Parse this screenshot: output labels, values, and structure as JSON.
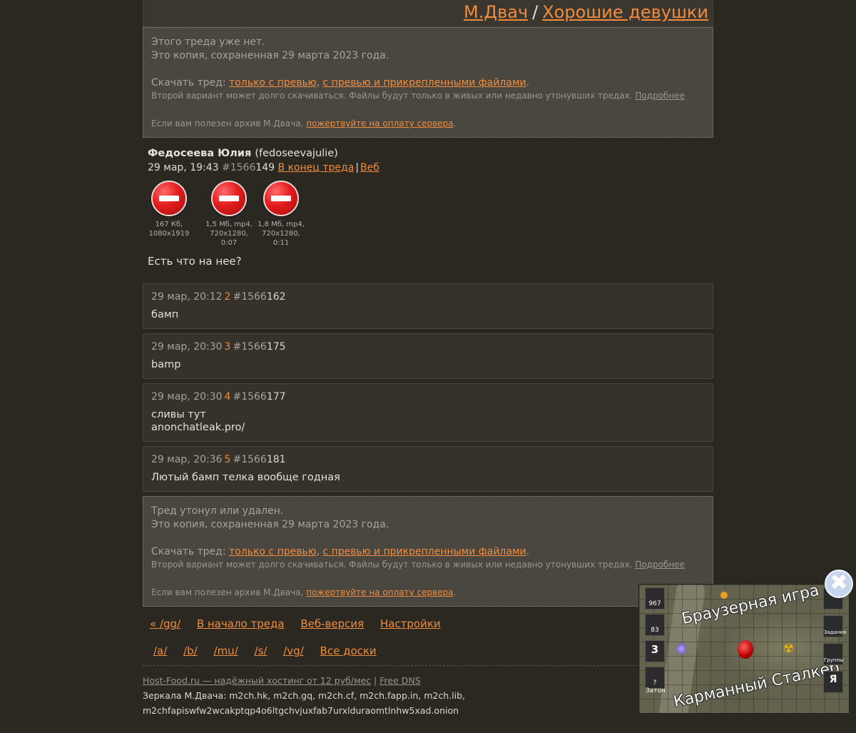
{
  "header": {
    "site": "М.Двач",
    "separator": "/",
    "board": "Хорошие девушки"
  },
  "top_notice": {
    "line1": "Этого треда уже нет.",
    "line2": "Это копия, сохраненная 29 марта 2023 года.",
    "download_prefix": "Скачать тред: ",
    "download_link1": "только с превью",
    "download_comma": ", ",
    "download_link2": "с превью и прикрепленными файлами",
    "download_dot": ".",
    "small_note": "Второй вариант может долго скачиваться. Файлы будут только в живых или недавно утонувших тредах. ",
    "more_link": "Подробнее",
    "donate_prefix": "Если вам полезен архив М.Двача, ",
    "donate_link": "пожертвуйте на оплату сервера",
    "donate_dot": "."
  },
  "op": {
    "name": "Федосеева Юлия",
    "nick": "(fedoseevajulie)",
    "date": "29 мар, 19:43",
    "num_prefix": "#1566",
    "num_suffix": "149",
    "to_end_link": "В конец треда",
    "bar": "|",
    "web_link": "Веб",
    "files": [
      {
        "info1": "167 Кб, 1080x1919",
        "info2": ""
      },
      {
        "info1": "1,5 Мб, mp4,",
        "info2": "720x1280, 0:07"
      },
      {
        "info1": "1,8 Мб, mp4,",
        "info2": "720x1280, 0:11"
      }
    ],
    "text": "Есть что на нее?"
  },
  "posts": [
    {
      "date": "29 мар, 20:12",
      "n": "2",
      "num_prefix": "#1566",
      "num_suffix": "162",
      "body1": "бамп",
      "body2": ""
    },
    {
      "date": "29 мар, 20:30",
      "n": "3",
      "num_prefix": "#1566",
      "num_suffix": "175",
      "body1": "bamp",
      "body2": ""
    },
    {
      "date": "29 мар, 20:30",
      "n": "4",
      "num_prefix": "#1566",
      "num_suffix": "177",
      "body1": "сливы тут",
      "body2": "anonchatleak.pro/"
    },
    {
      "date": "29 мар, 20:36",
      "n": "5",
      "num_prefix": "#1566",
      "num_suffix": "181",
      "body1": "Лютый бамп телка вообще годная",
      "body2": ""
    }
  ],
  "bottom_notice": {
    "line1": "Тред утонул или удален.",
    "line2": "Это копия, сохраненная 29 марта 2023 года.",
    "download_prefix": "Скачать тред: ",
    "download_link1": "только с превью",
    "download_comma": ", ",
    "download_link2": "с превью и прикрепленными файлами",
    "download_dot": ".",
    "small_note": "Второй вариант может долго скачиваться. Файлы будут только в живых или недавно утонувших тредах. ",
    "more_link": "Подробнее",
    "donate_prefix": "Если вам полезен архив М.Двача, ",
    "donate_link": "пожертвуйте на оплату сервера",
    "donate_dot": "."
  },
  "nav": {
    "back": "« /gg/",
    "thread_start": "В начало треда",
    "web_version": "Веб-версия",
    "settings": "Настройки"
  },
  "boards": [
    "/a/",
    "/b/",
    "/mu/",
    "/s/",
    "/vg/",
    "Все доски"
  ],
  "footer": {
    "hosting": "Host-Food.ru — надёжный хостинг от 12 руб/мес",
    "pipe": "|",
    "dns": "Free DNS",
    "mirrors_line1": "Зеркала М.Двача: m2ch.hk, m2ch.gq, m2ch.cf, m2ch.fapp.in, m2ch.lib,",
    "mirrors_line2": "m2chfapiswfw2wcakptqp4o6ltgchvjuxfab7urxlduraomtlnhw5xad.onion"
  },
  "ad": {
    "title1": "Браузерная игра",
    "title2": "Карманный Сталкер",
    "left_values": [
      "967",
      "83",
      "3",
      "?"
    ],
    "left_label": "Затон",
    "right_labels": [
      "",
      "Задания",
      "Группы",
      "Я"
    ],
    "close_glyph": "✖"
  },
  "colors": {
    "background": "#2b2822",
    "link": "#f08c3c",
    "notice_bg": "#4a4741",
    "post_bg": "#35312b"
  }
}
